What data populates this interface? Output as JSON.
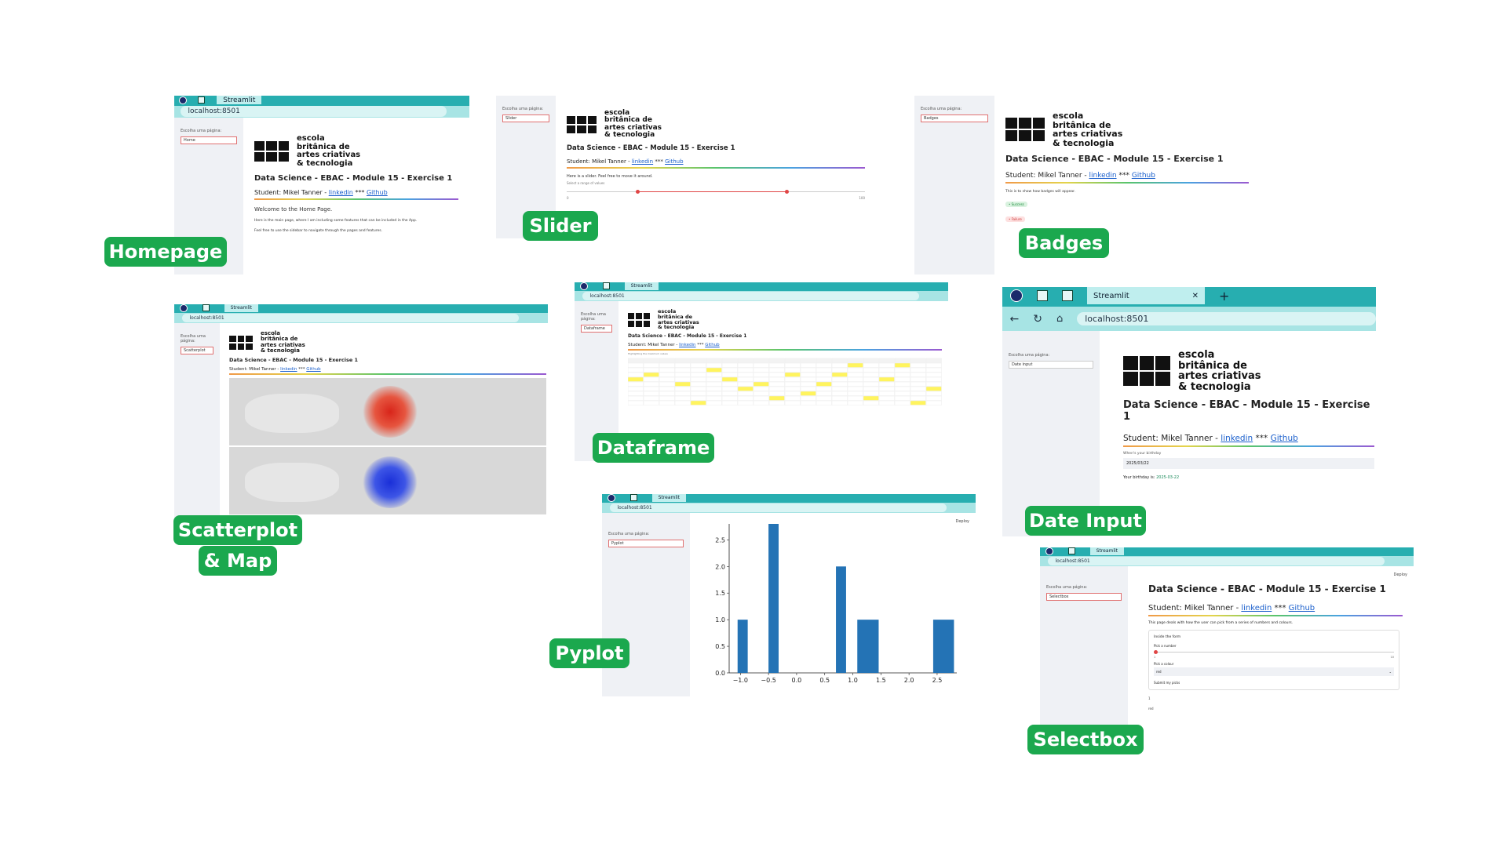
{
  "common": {
    "tab_title": "Streamlit",
    "url": "localhost:8501",
    "sidebar_label": "Escolha uma página:",
    "logo": [
      "escola",
      "britânica de",
      "artes criativas",
      "& tecnologia"
    ],
    "course_title": "Data Science - EBAC - Module 15 - Exercise 1",
    "student_prefix": "Student: Mikel Tanner - ",
    "link_linkedin": "linkedin",
    "sep": " *** ",
    "link_github": "Github"
  },
  "labels": {
    "homepage": "Homepage",
    "slider": "Slider",
    "badges": "Badges",
    "scatter1": "Scatterplot",
    "scatter2": "& Map",
    "dataframe": "Dataframe",
    "date_input": "Date Input",
    "pyplot": "Pyplot",
    "selectbox": "Selectbox"
  },
  "homepage": {
    "select": "Home",
    "welcome": "Welcome to the Home Page.",
    "p1": "Here is the main page, where I am including some features that can be included in the App.",
    "p2": "Feel free to use the sidebar to navigate through the pages and features."
  },
  "slider": {
    "select": "Slider",
    "p1": "Here is a slider. Feel free to move it around.",
    "p2": "Select a range of values",
    "min": "0",
    "max": "100"
  },
  "badges": {
    "select": "Badges",
    "p1": "This is to show how badges will appear.",
    "b1": "• Success",
    "b2": "• Failure"
  },
  "scatter": {
    "select": "Scatterplot"
  },
  "dataframe": {
    "select": "Dataframe",
    "caption": "Highlighting the maximum values"
  },
  "date": {
    "select": "Date input",
    "question": "When's your birthday",
    "value": "2025/03/22",
    "answer_label": "Your birthday is:",
    "answer_value": "2025-03-22"
  },
  "pyplot": {
    "select": "Pyplot",
    "deploy": "Deploy"
  },
  "selectbox": {
    "select": "Selectbox",
    "deploy": "Deploy",
    "p1": "This page deals with how the user can pick from a series of numbers and colours.",
    "form_title": "Inside the form",
    "pick_number": "Pick a number",
    "num_min": "1",
    "num_max": "10",
    "pick_color": "Pick a colour",
    "color_value": "red",
    "submit": "Submit my picks",
    "result_number": "1",
    "result_color": "red"
  },
  "chart_data": {
    "type": "bar",
    "x_ticks": [
      "−1.0",
      "−0.5",
      "0.0",
      "0.5",
      "1.0",
      "1.5",
      "2.0",
      "2.5"
    ],
    "y_ticks": [
      "0.0",
      "0.5",
      "1.0",
      "1.5",
      "2.0",
      "2.5"
    ],
    "xlim": [
      -1.2,
      2.85
    ],
    "ylim": [
      0,
      2.8
    ],
    "bars": [
      {
        "x0": -1.05,
        "x1": -0.87,
        "value": 1
      },
      {
        "x0": -0.5,
        "x1": -0.32,
        "value": 2.8
      },
      {
        "x0": 0.7,
        "x1": 0.88,
        "value": 2
      },
      {
        "x0": 1.08,
        "x1": 1.46,
        "value": 1
      },
      {
        "x0": 2.43,
        "x1": 2.8,
        "value": 1
      }
    ],
    "color": "#2473b5"
  },
  "colors": {
    "label_bg": "#1ba84e",
    "chrome": "#27aeb0",
    "highlight": "#fff45e"
  }
}
